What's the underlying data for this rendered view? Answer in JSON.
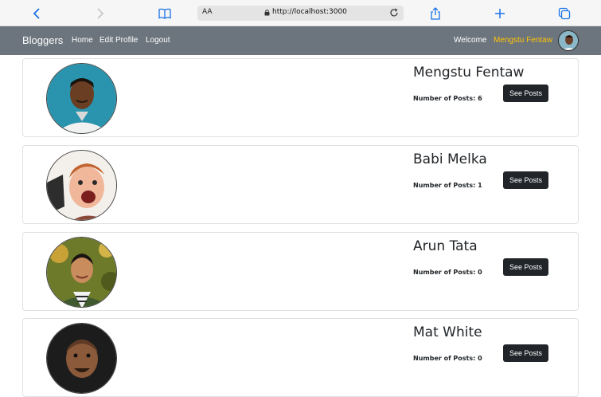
{
  "browser": {
    "url": "http://localhost:3000",
    "aa_label": "AA"
  },
  "navbar": {
    "brand": "Bloggers",
    "links": [
      "Home",
      "Edit Profile",
      "Logout"
    ],
    "welcome": "Welcome",
    "user_name": "Mengstu Fentaw"
  },
  "bloggers": [
    {
      "name": "Mengstu Fentaw",
      "posts_label": "Number of Posts: 6",
      "button": "See Posts"
    },
    {
      "name": "Babi Melka",
      "posts_label": "Number of Posts: 1",
      "button": "See Posts"
    },
    {
      "name": "Arun Tata",
      "posts_label": "Number of Posts: 0",
      "button": "See Posts"
    },
    {
      "name": "Mat White",
      "posts_label": "Number of Posts: 0",
      "button": "See Posts"
    }
  ],
  "colors": {
    "navbar_bg": "#6c757d",
    "accent_user": "#ffc107",
    "button_bg": "#212529",
    "browser_icon": "#1a73e8"
  }
}
